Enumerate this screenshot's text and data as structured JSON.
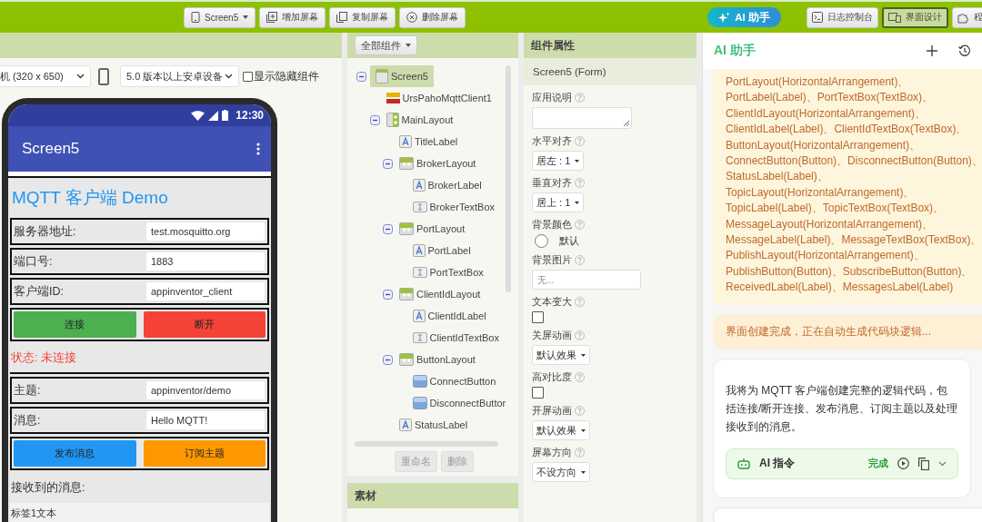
{
  "toolbar": {
    "screen_menu": "Screen5",
    "buttons": [
      {
        "label": "增加屏幕",
        "kind": "add"
      },
      {
        "label": "复制屏幕",
        "kind": "copy"
      },
      {
        "label": "删除屏幕",
        "kind": "delete"
      }
    ],
    "ai_button": "AI 助手",
    "views": [
      {
        "label": "日志控制台",
        "kind": "console",
        "selected": false
      },
      {
        "label": "界面设计",
        "kind": "design",
        "selected": true
      },
      {
        "label": "程",
        "kind": "blocks",
        "selected": false
      }
    ]
  },
  "designer": {
    "device_select": "机 (320 x 650)",
    "version_select": "5.0 版本以上安卓设备",
    "show_hidden": {
      "label": "显示隐藏组件",
      "checked": false
    },
    "phone": {
      "time": "12:30",
      "app_title": "Screen5",
      "rows": [
        {
          "kind": "title",
          "text": "MQTT 客户端 Demo"
        },
        {
          "kind": "field",
          "label": "服务器地址:",
          "value": "test.mosquitto.org"
        },
        {
          "kind": "field",
          "label": "端口号:",
          "value": "1883"
        },
        {
          "kind": "field",
          "label": "客户端ID:",
          "value": "appinventor_client"
        },
        {
          "kind": "buttons",
          "buttons": [
            {
              "label": "连接",
              "color": "#4caf50"
            },
            {
              "label": "断开",
              "color": "#f44336"
            }
          ]
        },
        {
          "kind": "status",
          "text": "状态: 未连接"
        },
        {
          "kind": "field",
          "label": "主题:",
          "value": "appinventor/demo"
        },
        {
          "kind": "field",
          "label": "消息:",
          "value": "Hello MQTT!"
        },
        {
          "kind": "buttons",
          "buttons": [
            {
              "label": "发布消息",
              "color": "#2196f3"
            },
            {
              "label": "订阅主题",
              "color": "#ff9800"
            }
          ]
        },
        {
          "kind": "heading",
          "text": "接收到的消息:"
        },
        {
          "kind": "text",
          "text": "标签1文本"
        }
      ]
    }
  },
  "components": {
    "filter": "全部组件",
    "tree": [
      {
        "label": "Screen5",
        "kind": "screen",
        "selected": true,
        "expanded": true,
        "children": [
          {
            "label": "UrsPahoMqttClient1",
            "kind": "mqtt",
            "selected": false
          },
          {
            "label": "MainLayout",
            "kind": "vertical",
            "selected": false,
            "expanded": true,
            "children": [
              {
                "label": "TitleLabel",
                "kind": "label",
                "selected": false
              },
              {
                "label": "BrokerLayout",
                "kind": "horizontal",
                "selected": false,
                "expanded": true,
                "children": [
                  {
                    "label": "BrokerLabel",
                    "kind": "label",
                    "selected": false
                  },
                  {
                    "label": "BrokerTextBox",
                    "kind": "textbox",
                    "selected": false
                  }
                ]
              },
              {
                "label": "PortLayout",
                "kind": "horizontal",
                "selected": false,
                "expanded": true,
                "children": [
                  {
                    "label": "PortLabel",
                    "kind": "label",
                    "selected": false
                  },
                  {
                    "label": "PortTextBox",
                    "kind": "textbox",
                    "selected": false
                  }
                ]
              },
              {
                "label": "ClientIdLayout",
                "kind": "horizontal",
                "selected": false,
                "expanded": true,
                "children": [
                  {
                    "label": "ClientIdLabel",
                    "kind": "label",
                    "selected": false
                  },
                  {
                    "label": "ClientIdTextBox",
                    "kind": "textbox",
                    "selected": false
                  }
                ]
              },
              {
                "label": "ButtonLayout",
                "kind": "horizontal",
                "selected": false,
                "expanded": true,
                "children": [
                  {
                    "label": "ConnectButton",
                    "kind": "button",
                    "selected": false
                  },
                  {
                    "label": "DisconnectButtor",
                    "kind": "button",
                    "selected": false
                  }
                ]
              },
              {
                "label": "StatusLabel",
                "kind": "label",
                "selected": false
              }
            ]
          }
        ]
      }
    ],
    "rename": {
      "label": "重命名",
      "disabled": true
    },
    "delete": {
      "label": "删除",
      "disabled": true
    }
  },
  "assets": {
    "title": "素材"
  },
  "properties": {
    "title": "组件属性",
    "component": "Screen5 (Form)",
    "items": [
      {
        "kind": "textarea",
        "label": "应用说明"
      },
      {
        "kind": "dropdown",
        "label": "水平对齐",
        "value": "居左 : 1"
      },
      {
        "kind": "dropdown",
        "label": "垂直对齐",
        "value": "居上 : 1"
      },
      {
        "kind": "color",
        "label": "背景颜色",
        "value": "默认"
      },
      {
        "kind": "field",
        "label": "背景图片",
        "placeholder": "无..."
      },
      {
        "kind": "checkbox",
        "label": "文本变大",
        "checked": false
      },
      {
        "kind": "dropdown",
        "label": "关屏动画",
        "value": "默认效果"
      },
      {
        "kind": "checkbox",
        "label": "高对比度",
        "checked": false
      },
      {
        "kind": "dropdown",
        "label": "开屏动画",
        "value": "默认效果"
      },
      {
        "kind": "dropdown",
        "label": "屏幕方向",
        "value": "不设方向"
      }
    ]
  },
  "ai": {
    "title": "AI 助手",
    "component_list": "PortLayout(HorizontalArrangement)、\nPortLabel(Label)、PortTextBox(TextBox)、\nClientIdLayout(HorizontalArrangement)、\nClientIdLabel(Label)、ClientIdTextBox(TextBox)、\nButtonLayout(HorizontalArrangement)、\nConnectButton(Button)、DisconnectButton(Button)、\nStatusLabel(Label)、\nTopicLayout(HorizontalArrangement)、\nTopicLabel(Label)、TopicTextBox(TextBox)、\nMessageLayout(HorizontalArrangement)、\nMessageLabel(Label)、MessageTextBox(TextBox)、\nPublishLayout(HorizontalArrangement)、\nPublishButton(Button)、SubscribeButton(Button)、\nReceivedLabel(Label)、MessagesLabel(Label)",
    "notice": "界面创建完成，正在自动生成代码块逻辑...",
    "reply": {
      "text": "我将为 MQTT 客户端创建完整的逻辑代码，包括连接/断开连接、发布消息、订阅主题以及处理接收到的消息。",
      "command": {
        "label": "AI 指令",
        "status": "完成"
      }
    }
  }
}
